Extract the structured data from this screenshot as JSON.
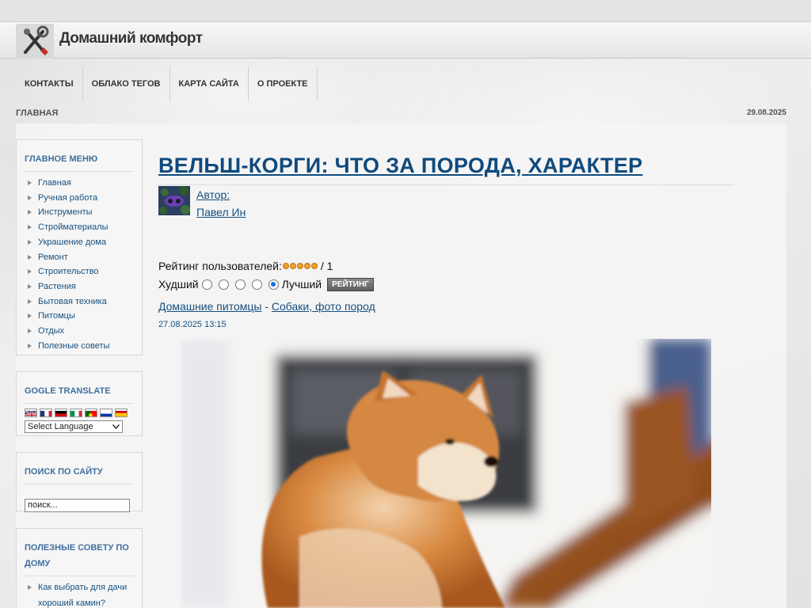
{
  "site": {
    "title": "Домашний комфорт"
  },
  "topnav": [
    "КОНТАКТЫ",
    "ОБЛАКО ТЕГОВ",
    "КАРТА САЙТА",
    "О ПРОЕКТЕ"
  ],
  "breadcrumb": "ГЛАВНАЯ",
  "date_top": "29.08.2025",
  "main_menu": {
    "title": "ГЛАВНОЕ МЕНЮ",
    "items": [
      "Главная",
      "Ручная работа",
      "Инструменты",
      "Стройматериалы",
      "Украшение дома",
      "Ремонт",
      "Строительство",
      "Растения",
      "Бытовая техника",
      "Питомцы",
      "Отдых",
      "Полезные советы"
    ]
  },
  "translate": {
    "title": "GOGLE TRANSLATE",
    "select_value": "Select Language"
  },
  "search": {
    "title": "ПОИСК ПО САЙТУ",
    "value": "поиск..."
  },
  "useful": {
    "title": "ПОЛЕЗНЫЕ СОВЕТУ ПО ДОМУ",
    "items": [
      "Как выбрать для дачи хороший камин?"
    ]
  },
  "article": {
    "title": "ВЕЛЬШ-КОРГИ: ЧТО ЗА ПОРОДА, ХАРАКТЕР",
    "author_label": "Автор:",
    "author_name": "Павел Ин",
    "rating_label": "Рейтинг пользователей:",
    "rating_count": "/ 1",
    "vote_worst": "Худший",
    "vote_best": "Лучший",
    "rate_button": "РЕЙТИНГ",
    "category": "Домашние питомцы",
    "separator": "-",
    "subcategory": "Собаки, фото пород",
    "date": "27.08.2025 13:15"
  }
}
